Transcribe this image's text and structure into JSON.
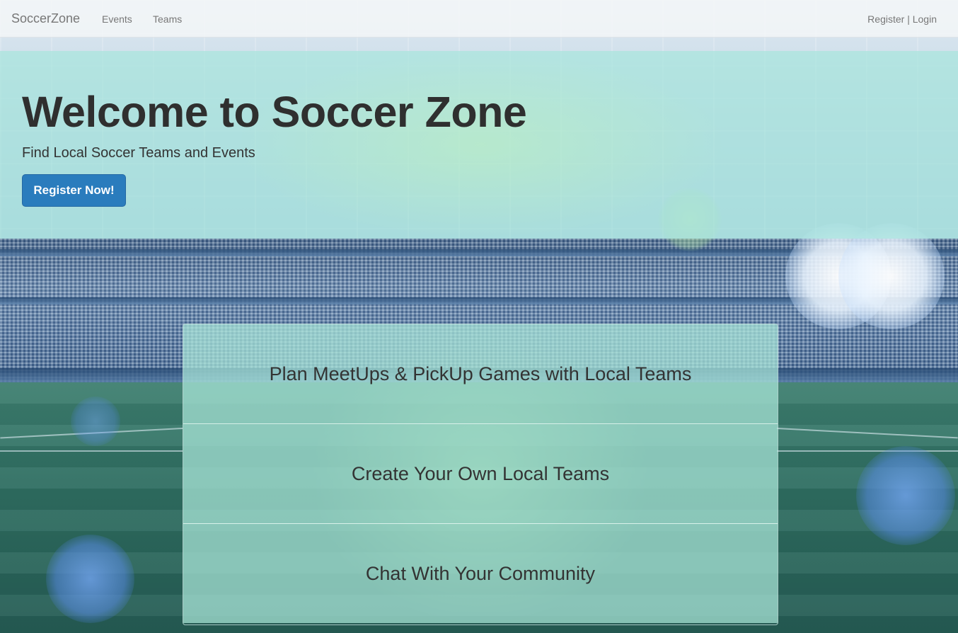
{
  "navbar": {
    "brand": "SoccerZone",
    "links": [
      {
        "label": "Events"
      },
      {
        "label": "Teams"
      }
    ],
    "register_label": "Register",
    "separator": "|",
    "login_label": "Login"
  },
  "hero": {
    "title": "Welcome to Soccer Zone",
    "subtitle": "Find Local Soccer Teams and Events",
    "cta_label": "Register Now!"
  },
  "features": [
    {
      "label": "Plan MeetUps & PickUp Games with Local Teams"
    },
    {
      "label": "Create Your Own Local Teams"
    },
    {
      "label": "Chat With Your Community"
    }
  ],
  "colors": {
    "primary_button": "#2a7cbd",
    "hero_overlay": "#a8e5dd",
    "navbar_bg": "#f4f6f8"
  }
}
